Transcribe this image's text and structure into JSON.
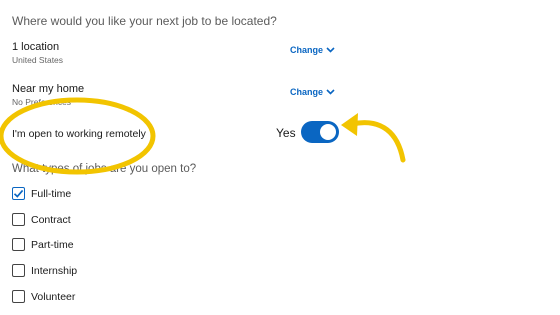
{
  "location_question": "Where would you like your next job to be located?",
  "locations": [
    {
      "title": "1 location",
      "subtitle": "United States",
      "action": "Change",
      "icon": "chevron-down-icon"
    },
    {
      "title": "Near my home",
      "subtitle": "No Preferences",
      "action": "Change",
      "icon": "chevron-down-icon"
    }
  ],
  "remote": {
    "label": "I'm open to working remotely",
    "state_label": "Yes",
    "enabled": true
  },
  "job_types_question": "What types of jobs are you open to?",
  "job_types": [
    {
      "label": "Full-time",
      "checked": true
    },
    {
      "label": "Contract",
      "checked": false
    },
    {
      "label": "Part-time",
      "checked": false
    },
    {
      "label": "Internship",
      "checked": false
    },
    {
      "label": "Volunteer",
      "checked": false
    }
  ],
  "colors": {
    "accent": "#0a66c2",
    "highlight": "#f2c400"
  }
}
